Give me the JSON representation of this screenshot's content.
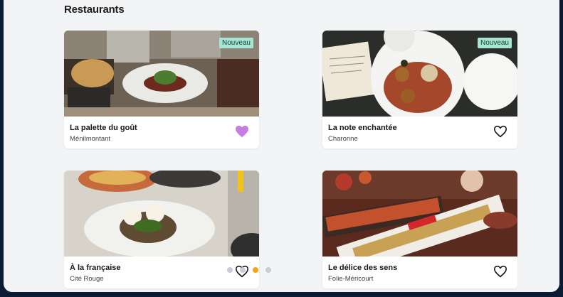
{
  "section": {
    "title": "Restaurants"
  },
  "restaurants": [
    {
      "name": "La palette du goût",
      "area": "Ménilmontant",
      "badge": "Nouveau",
      "favorite": true
    },
    {
      "name": "La note enchantée",
      "area": "Charonne",
      "badge": "Nouveau",
      "favorite": false
    },
    {
      "name": "À la française",
      "area": "Cité Rouge",
      "badge": "",
      "favorite": false
    },
    {
      "name": "Le délice des sens",
      "area": "Folie-Méricourt",
      "badge": "",
      "favorite": false
    }
  ],
  "carousel": {
    "active_index": 2,
    "count": 4
  },
  "colors": {
    "favorite_fill": "#c77ddf",
    "badge_bg": "#a6e6d2",
    "dot_active": "#f2a516",
    "dot_inactive": "#c7ccd6"
  }
}
